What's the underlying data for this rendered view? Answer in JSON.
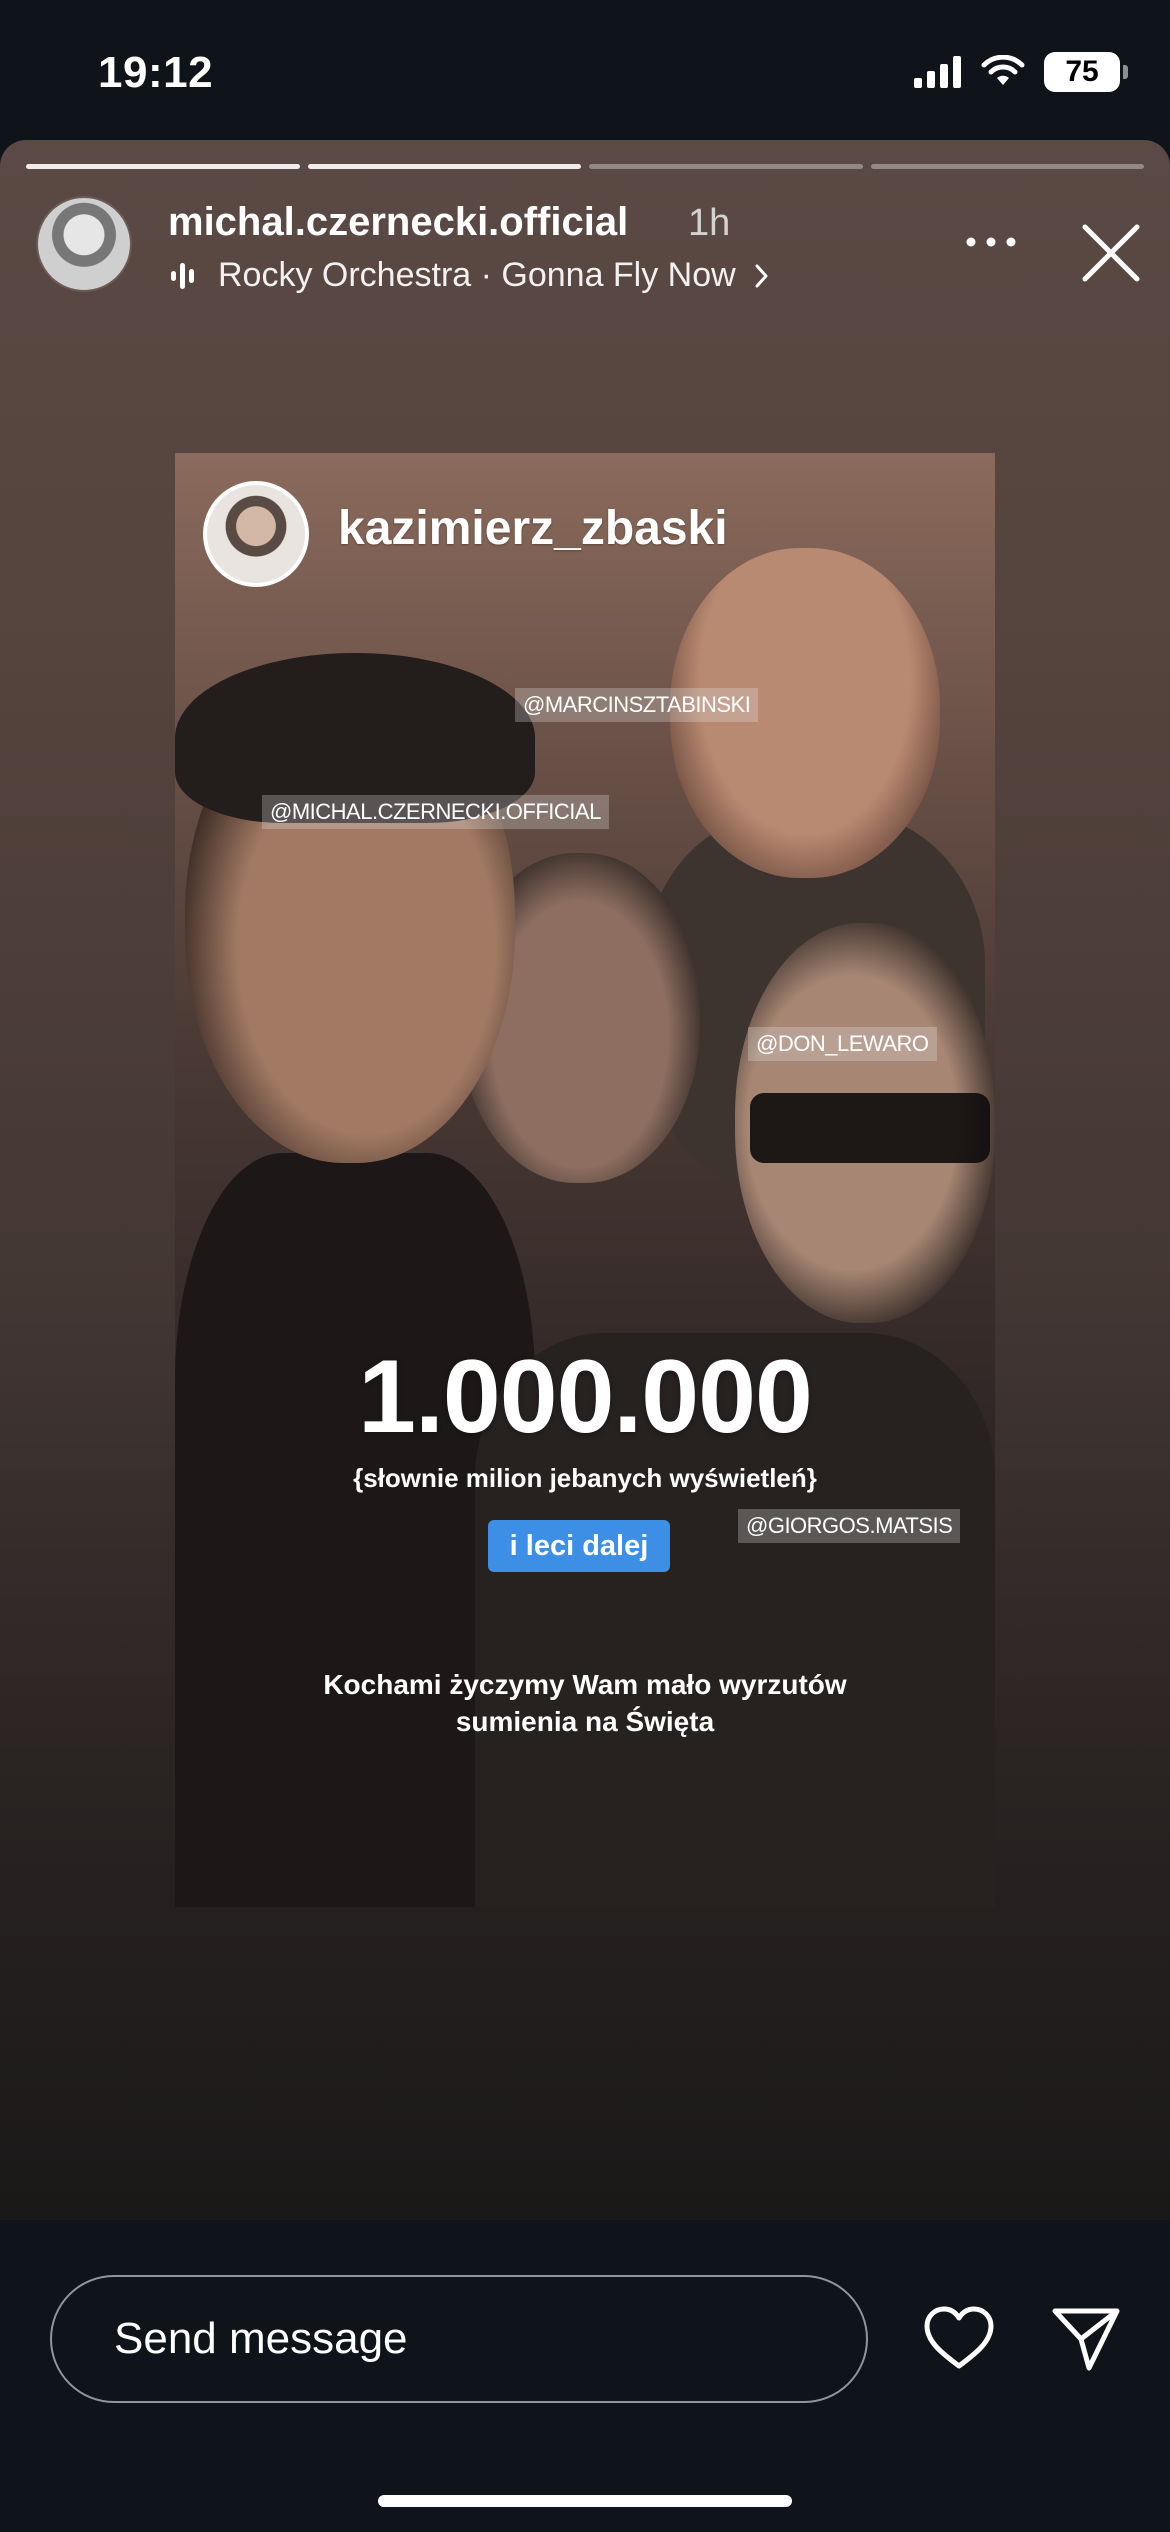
{
  "status_bar": {
    "time": "19:12",
    "battery": "75",
    "icons": [
      "signal-icon",
      "wifi-icon",
      "battery-icon"
    ]
  },
  "story": {
    "progress": {
      "segments": 4,
      "completed": 2,
      "current_fraction": 0.0
    },
    "username": "michal.czernecki.official",
    "time_ago": "1h",
    "music": "Rocky Orchestra · Gonna Fly Now",
    "more_icon": "more-horizontal-icon",
    "close_icon": "close-icon",
    "background_color": "#55433d"
  },
  "repost": {
    "username": "kazimierz_zbaski",
    "mentions": {
      "marcin": "@MARCINSZTABINSKI",
      "michal": "@MICHAL.CZERNECKI.OFFICIAL",
      "don": "@DON_LEWARO",
      "giorgos": "@GIORGOS.MATSIS"
    },
    "headline": "1.000.000",
    "subline": "{słownie milion jebanych wyświetleń}",
    "pill": "i leci dalej",
    "pill_color": "#3d8fe6",
    "caption_line1": "Kochami życzymy Wam mało wyrzutów",
    "caption_line2": "sumienia na Święta"
  },
  "bottom_bar": {
    "placeholder": "Send message",
    "heart_icon": "heart-icon",
    "send_icon": "send-icon"
  }
}
